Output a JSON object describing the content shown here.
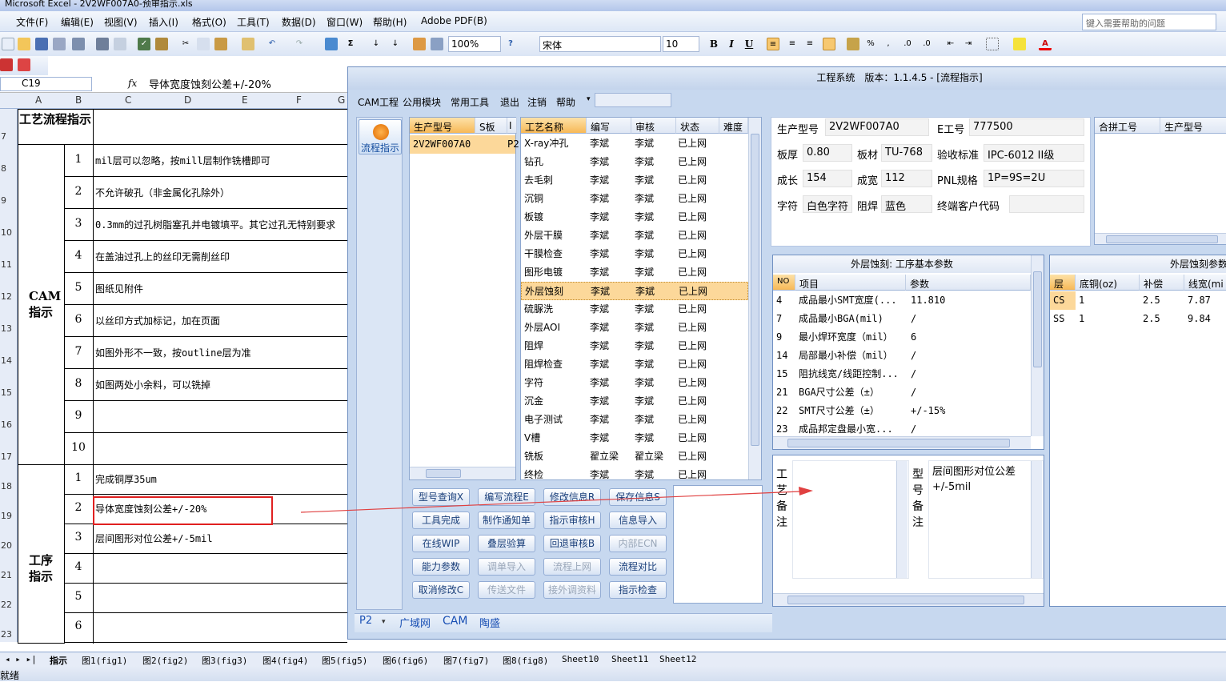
{
  "excel": {
    "title": "Microsoft Excel - 2V2WF007A0-预审指示.xls",
    "menu": [
      "文件(F)",
      "编辑(E)",
      "视图(V)",
      "插入(I)",
      "格式(O)",
      "工具(T)",
      "数据(D)",
      "窗口(W)",
      "帮助(H)",
      "Adobe PDF(B)"
    ],
    "help_placeholder": "键入需要帮助的问题",
    "zoom": "100%",
    "font": "宋体",
    "font_size": "10",
    "name_box": "C19",
    "fx": "fx",
    "formula": "导体宽度蚀刻公差+/-20%",
    "columns": [
      "A",
      "B",
      "C",
      "D",
      "E",
      "F",
      "G"
    ],
    "rows": [
      "7",
      "8",
      "9",
      "10",
      "11",
      "12",
      "13",
      "14",
      "15",
      "16",
      "17",
      "18",
      "19",
      "20",
      "21",
      "22",
      "23"
    ],
    "header_label": "工艺流程指示",
    "group1": "CAM指示",
    "group2": "工序指示",
    "cam_items": [
      {
        "n": "1",
        "t": "mil层可以忽略，按mill层制作铣槽即可"
      },
      {
        "n": "2",
        "t": "不允许破孔（非金属化孔除外）"
      },
      {
        "n": "3",
        "t": "0.3mm的过孔树脂塞孔并电镀填平。其它过孔无特别要求"
      },
      {
        "n": "4",
        "t": "在盖油过孔上的丝印无需削丝印"
      },
      {
        "n": "5",
        "t": "图纸见附件"
      },
      {
        "n": "6",
        "t": "以丝印方式加标记，加在页面"
      },
      {
        "n": "7",
        "t": "如图外形不一致，按outline层为准"
      },
      {
        "n": "8",
        "t": "如图两处小余料，可以铣掉"
      },
      {
        "n": "9",
        "t": ""
      },
      {
        "n": "10",
        "t": ""
      }
    ],
    "proc_items": [
      {
        "n": "1",
        "t": "完成铜厚35um"
      },
      {
        "n": "2",
        "t": "导体宽度蚀刻公差+/-20%"
      },
      {
        "n": "3",
        "t": "层间图形对位公差+/-5mil"
      },
      {
        "n": "4",
        "t": ""
      },
      {
        "n": "5",
        "t": ""
      },
      {
        "n": "6",
        "t": ""
      }
    ],
    "sheets": [
      "指示",
      "图1(fig1)",
      "图2(fig2)",
      "图3(fig3)",
      "图4(fig4)",
      "图5(fig5)",
      "图6(fig6)",
      "图7(fig7)",
      "图8(fig8)",
      "Sheet10",
      "Sheet11",
      "Sheet12"
    ],
    "status": "就绪"
  },
  "app": {
    "title": "工程系统　版本：1.1.4.5 - [流程指示]",
    "menu": [
      "CAM工程",
      "公用模块",
      "常用工具",
      "退出",
      "注销",
      "帮助"
    ],
    "side_button": "流程指示",
    "model_headers": [
      "生产型号",
      "S板",
      "I"
    ],
    "model_row": {
      "model": "2V2WF007A0",
      "s": "P2"
    },
    "proc_headers": [
      "工艺名称",
      "编写",
      "审核",
      "状态",
      "难度"
    ],
    "processes": [
      {
        "name": "X-ray冲孔",
        "w": "李斌",
        "r": "李斌",
        "s": "已上网"
      },
      {
        "name": "钻孔",
        "w": "李斌",
        "r": "李斌",
        "s": "已上网"
      },
      {
        "name": "去毛刺",
        "w": "李斌",
        "r": "李斌",
        "s": "已上网"
      },
      {
        "name": "沉铜",
        "w": "李斌",
        "r": "李斌",
        "s": "已上网"
      },
      {
        "name": "板镀",
        "w": "李斌",
        "r": "李斌",
        "s": "已上网"
      },
      {
        "name": "外层干膜",
        "w": "李斌",
        "r": "李斌",
        "s": "已上网"
      },
      {
        "name": "干膜检查",
        "w": "李斌",
        "r": "李斌",
        "s": "已上网"
      },
      {
        "name": "图形电镀",
        "w": "李斌",
        "r": "李斌",
        "s": "已上网"
      },
      {
        "name": "外层蚀刻",
        "w": "李斌",
        "r": "李斌",
        "s": "已上网"
      },
      {
        "name": "硫脲洗",
        "w": "李斌",
        "r": "李斌",
        "s": "已上网"
      },
      {
        "name": "外层AOI",
        "w": "李斌",
        "r": "李斌",
        "s": "已上网"
      },
      {
        "name": "阻焊",
        "w": "李斌",
        "r": "李斌",
        "s": "已上网"
      },
      {
        "name": "阻焊检查",
        "w": "李斌",
        "r": "李斌",
        "s": "已上网"
      },
      {
        "name": "字符",
        "w": "李斌",
        "r": "李斌",
        "s": "已上网"
      },
      {
        "name": "沉金",
        "w": "李斌",
        "r": "李斌",
        "s": "已上网"
      },
      {
        "name": "电子测试",
        "w": "李斌",
        "r": "李斌",
        "s": "已上网"
      },
      {
        "name": "V槽",
        "w": "李斌",
        "r": "李斌",
        "s": "已上网"
      },
      {
        "name": "铣板",
        "w": "翟立梁",
        "r": "翟立梁",
        "s": "已上网"
      },
      {
        "name": "终检",
        "w": "李斌",
        "r": "李斌",
        "s": "已上网"
      }
    ],
    "selected_process": "外层蚀刻",
    "buttons": [
      {
        "label": "型号查询X",
        "enabled": true
      },
      {
        "label": "编写流程E",
        "enabled": true
      },
      {
        "label": "修改信息R",
        "enabled": true
      },
      {
        "label": "保存信息S",
        "enabled": true
      },
      {
        "label": "工具完成",
        "enabled": true
      },
      {
        "label": "制作通知单",
        "enabled": true
      },
      {
        "label": "指示审核H",
        "enabled": true
      },
      {
        "label": "信息导入",
        "enabled": true
      },
      {
        "label": "在线WIP",
        "enabled": true
      },
      {
        "label": "叠层验算",
        "enabled": true
      },
      {
        "label": "回退审核B",
        "enabled": true
      },
      {
        "label": "内部ECN",
        "enabled": false
      },
      {
        "label": "能力参数",
        "enabled": true
      },
      {
        "label": "调单导入",
        "enabled": false
      },
      {
        "label": "流程上网",
        "enabled": false
      },
      {
        "label": "流程对比",
        "enabled": true
      },
      {
        "label": "取消修改C",
        "enabled": true
      },
      {
        "label": "传送文件",
        "enabled": false
      },
      {
        "label": "接外调资料",
        "enabled": false
      },
      {
        "label": "指示检查",
        "enabled": true
      }
    ],
    "info": {
      "model_label": "生产型号",
      "model": "2V2WF007A0",
      "e_label": "E工号",
      "e": "777500",
      "thick_label": "板厚",
      "thick": "0.80",
      "mat_label": "板材",
      "mat": "TU-768",
      "std_label": "验收标准",
      "std": "IPC-6012 II级",
      "len_label": "成长",
      "len": "154",
      "wid_label": "成宽",
      "wid": "112",
      "pnl_label": "PNL规格",
      "pnl": "1P=9S=2U",
      "char_label": "字符",
      "char": "白色字符",
      "mask_label": "阻焊",
      "mask": "蓝色",
      "cust_label": "终端客户代码",
      "cust": ""
    },
    "combine_headers": [
      "合拼工号",
      "生产型号"
    ],
    "param_title": "外层蚀刻: 工序基本参数",
    "param_headers": [
      "NO",
      "项目",
      "参数"
    ],
    "params": [
      {
        "no": "4",
        "item": "成品最小SMT宽度(...",
        "val": "11.810"
      },
      {
        "no": "7",
        "item": "成品最小BGA(mil)",
        "val": "/"
      },
      {
        "no": "9",
        "item": "最小焊环宽度（mil）",
        "val": "6"
      },
      {
        "no": "14",
        "item": "局部最小补偿（mil）",
        "val": "/"
      },
      {
        "no": "15",
        "item": "阻抗线宽/线距控制...",
        "val": "/"
      },
      {
        "no": "21",
        "item": "BGA尺寸公差（±）",
        "val": "/"
      },
      {
        "no": "22",
        "item": "SMT尺寸公差（±）",
        "val": "+/-15%"
      },
      {
        "no": "23",
        "item": "成品邦定盘最小宽...",
        "val": "/"
      }
    ],
    "right_title": "外层蚀刻参数",
    "right_headers": [
      "层",
      "底铜(oz)",
      "补偿",
      "线宽(mi"
    ],
    "right_rows": [
      {
        "l": "CS",
        "b": "1",
        "c": "2.5",
        "w": "7.87"
      },
      {
        "l": "SS",
        "b": "1",
        "c": "2.5",
        "w": "9.84"
      }
    ],
    "craft_note_label": "工艺备注",
    "model_note_label": "型号备注",
    "model_note": "层间图形对位公差+/-5mil",
    "bottom_combo": "P2",
    "bottom_tabs": [
      "广域网",
      "CAM",
      "陶盛"
    ]
  },
  "colors": {
    "accent": "#f7a53c",
    "selection_border": "#e02020",
    "arrow": "#e04040"
  }
}
